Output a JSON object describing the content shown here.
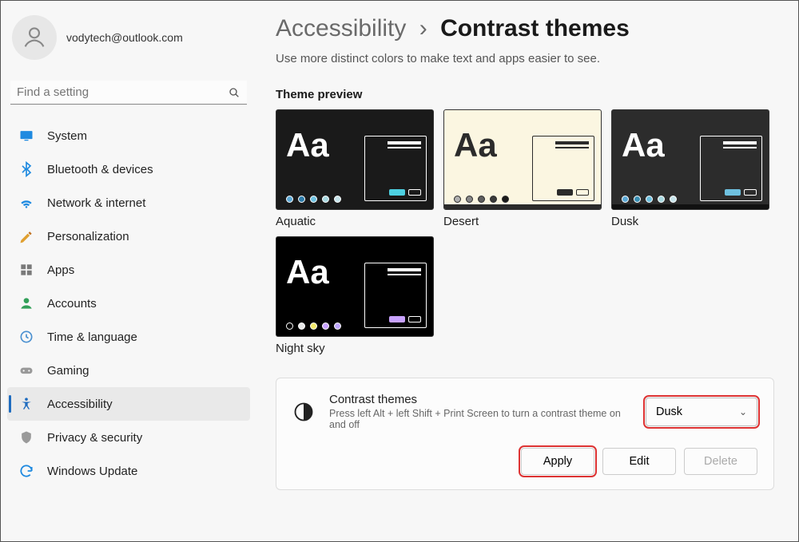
{
  "profile": {
    "email": "vodytech@outlook.com"
  },
  "search": {
    "placeholder": "Find a setting"
  },
  "nav": {
    "items": [
      {
        "label": "System",
        "icon": "system"
      },
      {
        "label": "Bluetooth & devices",
        "icon": "bluetooth"
      },
      {
        "label": "Network & internet",
        "icon": "network"
      },
      {
        "label": "Personalization",
        "icon": "personalization"
      },
      {
        "label": "Apps",
        "icon": "apps"
      },
      {
        "label": "Accounts",
        "icon": "accounts"
      },
      {
        "label": "Time & language",
        "icon": "time"
      },
      {
        "label": "Gaming",
        "icon": "gaming"
      },
      {
        "label": "Accessibility",
        "icon": "accessibility"
      },
      {
        "label": "Privacy & security",
        "icon": "privacy"
      },
      {
        "label": "Windows Update",
        "icon": "update"
      }
    ],
    "active": "Accessibility"
  },
  "breadcrumb": {
    "parent": "Accessibility",
    "separator": "›",
    "current": "Contrast themes"
  },
  "subtitle": "Use more distinct colors to make text and apps easier to see.",
  "section_title": "Theme preview",
  "themes": [
    {
      "name": "Aquatic",
      "variant": "aquatic"
    },
    {
      "name": "Desert",
      "variant": "desert"
    },
    {
      "name": "Dusk",
      "variant": "dusk"
    },
    {
      "name": "Night sky",
      "variant": "night"
    }
  ],
  "panel": {
    "title": "Contrast themes",
    "description": "Press left Alt + left Shift + Print Screen to turn a contrast theme on and off",
    "dropdown_value": "Dusk",
    "buttons": {
      "apply": "Apply",
      "edit": "Edit",
      "delete": "Delete"
    }
  }
}
